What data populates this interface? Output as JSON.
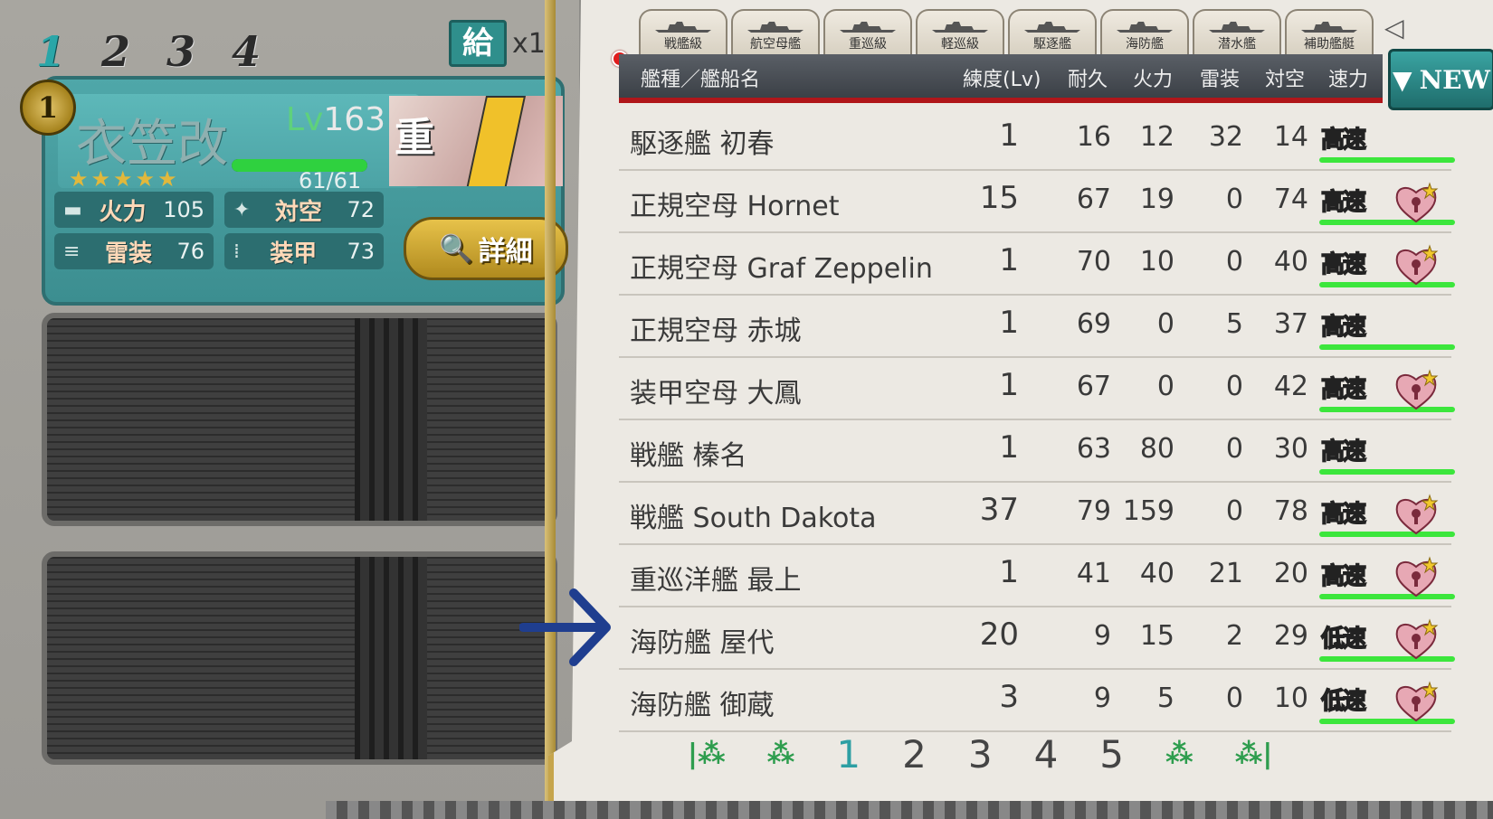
{
  "fleet": {
    "tabs": [
      "1",
      "2",
      "3",
      "4"
    ],
    "active": 0,
    "supply_label": "給",
    "supply_count": "x1"
  },
  "ship": {
    "slot": "1",
    "name": "衣笠改",
    "level_prefix": "Lv",
    "level": "163",
    "hp_text": "61/61",
    "hp_fraction": 1.0,
    "stars": "★★★★★",
    "portrait_mark": "重",
    "stats": [
      {
        "label": "火力",
        "value": "105",
        "icon": "cannon-icon"
      },
      {
        "label": "対空",
        "value": "72",
        "icon": "aa-gun-icon"
      },
      {
        "label": "雷装",
        "value": "76",
        "icon": "torpedo-icon"
      },
      {
        "label": "装甲",
        "value": "73",
        "icon": "armor-icon"
      }
    ],
    "detail_button": "詳細"
  },
  "type_tabs": [
    "戦艦級",
    "航空母艦",
    "重巡級",
    "軽巡級",
    "駆逐艦",
    "海防艦",
    "潜水艦",
    "補助艦艇"
  ],
  "header": {
    "name": "艦種／艦船名",
    "lv": "練度(Lv)",
    "hp": "耐久",
    "fp": "火力",
    "tp": "雷装",
    "aa": "対空",
    "speed": "速力"
  },
  "new_button": "NEW",
  "ships": [
    {
      "name": "駆逐艦 初春",
      "lv": "1",
      "hp": "16",
      "fp": "12",
      "tp": "32",
      "aa": "14",
      "speed": "高速",
      "locked": false
    },
    {
      "name": "正規空母 Hornet",
      "lv": "15",
      "hp": "67",
      "fp": "19",
      "tp": "0",
      "aa": "74",
      "speed": "高速",
      "locked": true
    },
    {
      "name": "正規空母 Graf Zeppelin",
      "lv": "1",
      "hp": "70",
      "fp": "10",
      "tp": "0",
      "aa": "40",
      "speed": "高速",
      "locked": true
    },
    {
      "name": "正規空母 赤城",
      "lv": "1",
      "hp": "69",
      "fp": "0",
      "tp": "5",
      "aa": "37",
      "speed": "高速",
      "locked": false
    },
    {
      "name": "装甲空母 大鳳",
      "lv": "1",
      "hp": "67",
      "fp": "0",
      "tp": "0",
      "aa": "42",
      "speed": "高速",
      "locked": true
    },
    {
      "name": "戦艦 榛名",
      "lv": "1",
      "hp": "63",
      "fp": "80",
      "tp": "0",
      "aa": "30",
      "speed": "高速",
      "locked": false
    },
    {
      "name": "戦艦 South Dakota",
      "lv": "37",
      "hp": "79",
      "fp": "159",
      "tp": "0",
      "aa": "78",
      "speed": "高速",
      "locked": true
    },
    {
      "name": "重巡洋艦 最上",
      "lv": "1",
      "hp": "41",
      "fp": "40",
      "tp": "21",
      "aa": "20",
      "speed": "高速",
      "locked": true
    },
    {
      "name": "海防艦 屋代",
      "lv": "20",
      "hp": "9",
      "fp": "15",
      "tp": "2",
      "aa": "29",
      "speed": "低速",
      "locked": true
    },
    {
      "name": "海防艦 御蔵",
      "lv": "3",
      "hp": "9",
      "fp": "5",
      "tp": "0",
      "aa": "10",
      "speed": "低速",
      "locked": true
    }
  ],
  "pager": {
    "pages": [
      "1",
      "2",
      "3",
      "4",
      "5"
    ],
    "current": 0
  }
}
